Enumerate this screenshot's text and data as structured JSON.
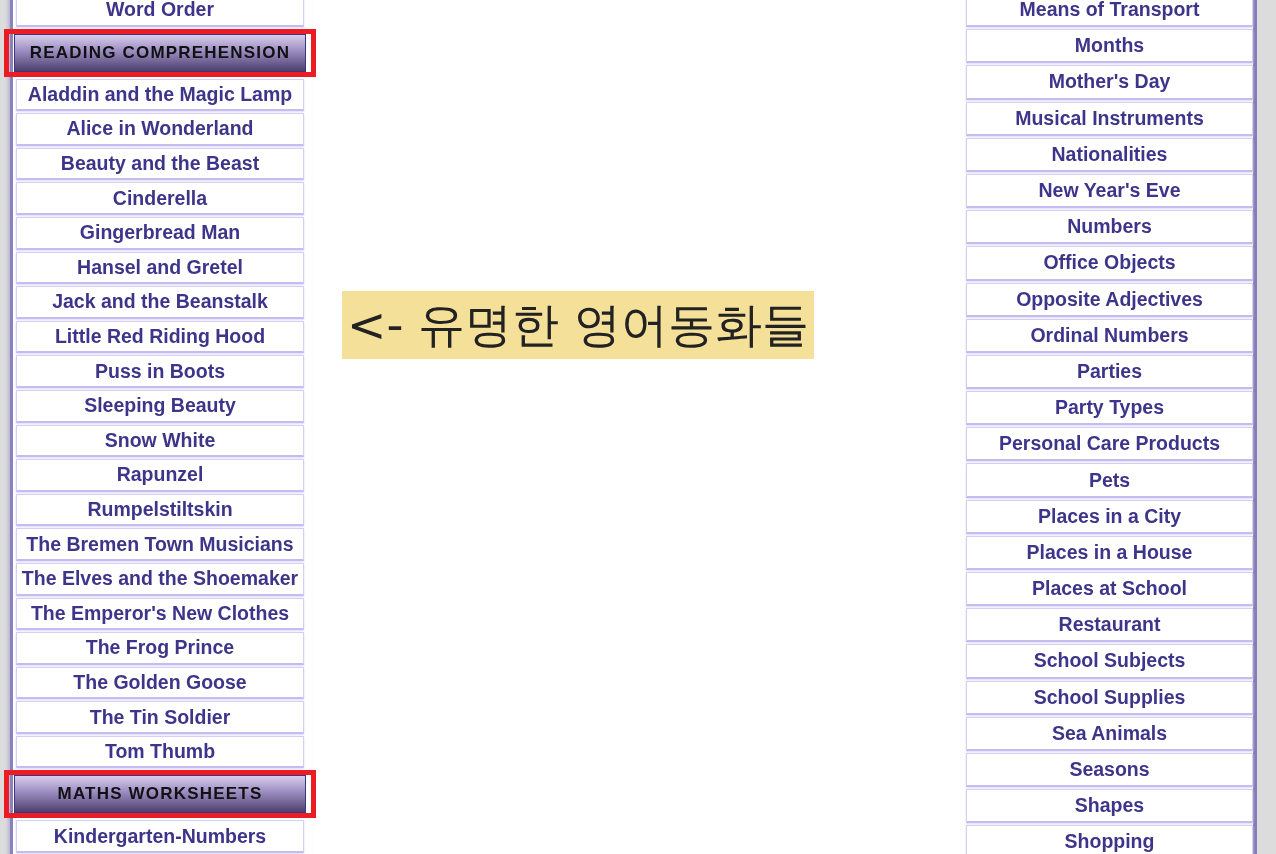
{
  "left_column": {
    "sections": [
      {
        "items": [
          "Word Order"
        ]
      },
      {
        "heading": "READING COMPREHENSION",
        "highlighted": true,
        "items": [
          "Aladdin and the Magic Lamp",
          "Alice in Wonderland",
          "Beauty and the Beast",
          "Cinderella",
          "Gingerbread Man",
          "Hansel and Gretel",
          "Jack and the Beanstalk",
          "Little Red Riding Hood",
          "Puss in Boots",
          "Sleeping Beauty",
          "Snow White",
          "Rapunzel",
          "Rumpelstiltskin",
          "The Bremen Town Musicians",
          "The Elves and the Shoemaker",
          "The Emperor's New Clothes",
          "The Frog Prince",
          "The Golden Goose",
          "The Tin Soldier",
          "Tom Thumb"
        ]
      },
      {
        "heading": "MATHS WORKSHEETS",
        "highlighted": true,
        "items": [
          "Kindergarten-Numbers"
        ]
      }
    ]
  },
  "callout": {
    "text": "<- 유명한 영어동화들"
  },
  "right_column": {
    "items": [
      "Means of Transport",
      "Months",
      "Mother's Day",
      "Musical Instruments",
      "Nationalities",
      "New Year's Eve",
      "Numbers",
      "Office Objects",
      "Opposite Adjectives",
      "Ordinal Numbers",
      "Parties",
      "Party Types",
      "Personal Care Products",
      "Pets",
      "Places in a City",
      "Places in a House",
      "Places at School",
      "Restaurant",
      "School Subjects",
      "School Supplies",
      "Sea Animals",
      "Seasons",
      "Shapes",
      "Shopping"
    ]
  }
}
